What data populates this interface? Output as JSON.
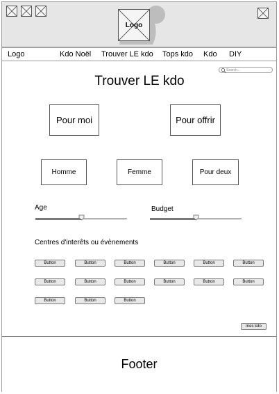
{
  "header": {
    "logo_label": "Logo"
  },
  "nav": {
    "items": [
      "Logo",
      "Kdo Noël",
      "Trouver LE kdo",
      "Tops kdo",
      "Kdo",
      "DIY"
    ]
  },
  "search": {
    "placeholder": "Search..."
  },
  "main": {
    "title": "Trouver LE kdo",
    "primary_choices": [
      "Pour moi",
      "Pour offrir"
    ],
    "secondary_choices": [
      "Homme",
      "Femme",
      "Pour deux"
    ],
    "sliders": [
      {
        "label": "Age",
        "value_fraction": 0.5
      },
      {
        "label": "Budget",
        "value_fraction": 0.5
      }
    ],
    "interests_label": "Centres d'interêts ou évènements",
    "interest_buttons": [
      "Button",
      "Button",
      "Button",
      "Button",
      "Button",
      "Button",
      "Button",
      "Button",
      "Button",
      "Button",
      "Button",
      "Button",
      "Button",
      "Button",
      "Button"
    ],
    "mes_kdo_label": "mes kdo"
  },
  "footer": {
    "label": "Footer"
  }
}
